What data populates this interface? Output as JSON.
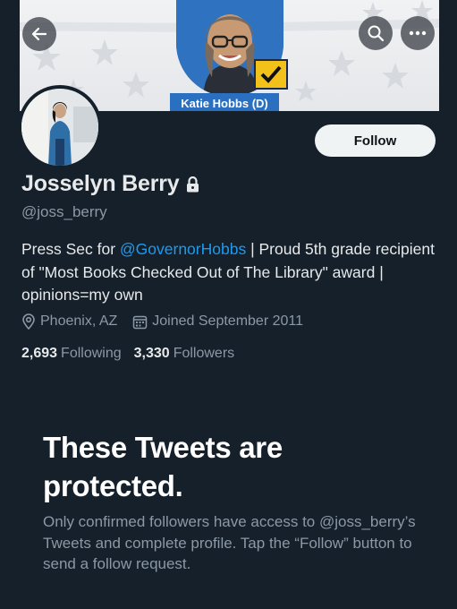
{
  "banner": {
    "candidate_label": "Katie Hobbs (D)"
  },
  "header": {
    "back_icon": "arrow-left-icon",
    "search_icon": "search-icon",
    "more_icon": "more-horizontal-icon"
  },
  "profile": {
    "follow_label": "Follow",
    "display_name": "Josselyn Berry",
    "lock_icon": "lock-icon",
    "handle": "@joss_berry",
    "bio": {
      "prefix": "Press Sec for ",
      "mention": "@GovernorHobbs",
      "suffix": " | Proud 5th grade recipient of \"Most Books Checked Out of The Library\" award | opinions=my own"
    },
    "location": "Phoenix, AZ",
    "joined": "Joined September 2011",
    "following_count": "2,693",
    "following_label": "Following",
    "followers_count": "3,330",
    "followers_label": "Followers"
  },
  "protected": {
    "title": "These Tweets are protected.",
    "description": "Only confirmed followers have access to @joss_berry’s Tweets and complete profile. Tap the “Follow” button to send a follow request."
  },
  "colors": {
    "background": "#15202b",
    "accent": "#1d9bf0",
    "secondary_text": "#8b98a5",
    "primary_text": "#e7e9ea"
  }
}
